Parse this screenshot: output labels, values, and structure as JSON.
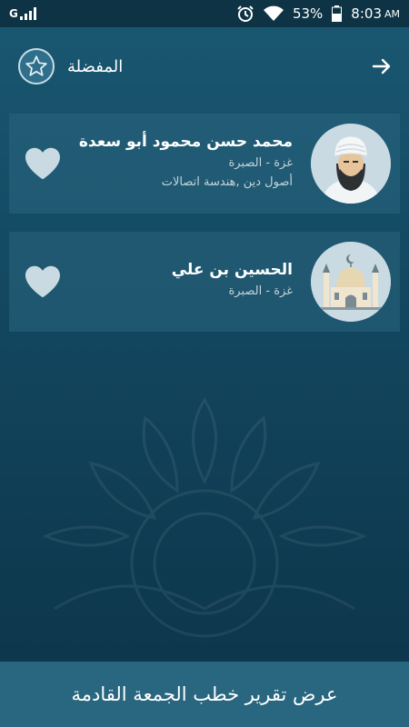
{
  "status_bar": {
    "network": "G",
    "battery_percent": "53%",
    "time": "8:03",
    "ampm": "AM",
    "icons": [
      "signal-icon",
      "alarm-icon",
      "wifi-icon",
      "battery-icon"
    ]
  },
  "header": {
    "title": "المفضلة",
    "star_icon": "star-icon",
    "back_icon": "arrow-right-icon"
  },
  "favorites": [
    {
      "name": "محمد حسن محمود أبو سعدة",
      "location": "غزة - الصبرة",
      "specialty": "أصول دين ,هندسة اتصالات",
      "avatar": "imam-avatar-icon"
    },
    {
      "name": "الحسين بن علي",
      "location": "غزة - الصبرة",
      "avatar": "mosque-avatar-icon"
    }
  ],
  "bottom_button": {
    "label": "عرض تقرير خطب الجمعة القادمة"
  },
  "colors": {
    "background_top": "#1a5872",
    "background_bottom": "#0c3448",
    "card": "#29647e",
    "bottom_bar": "#29667f",
    "heart": "#c9dae2"
  }
}
